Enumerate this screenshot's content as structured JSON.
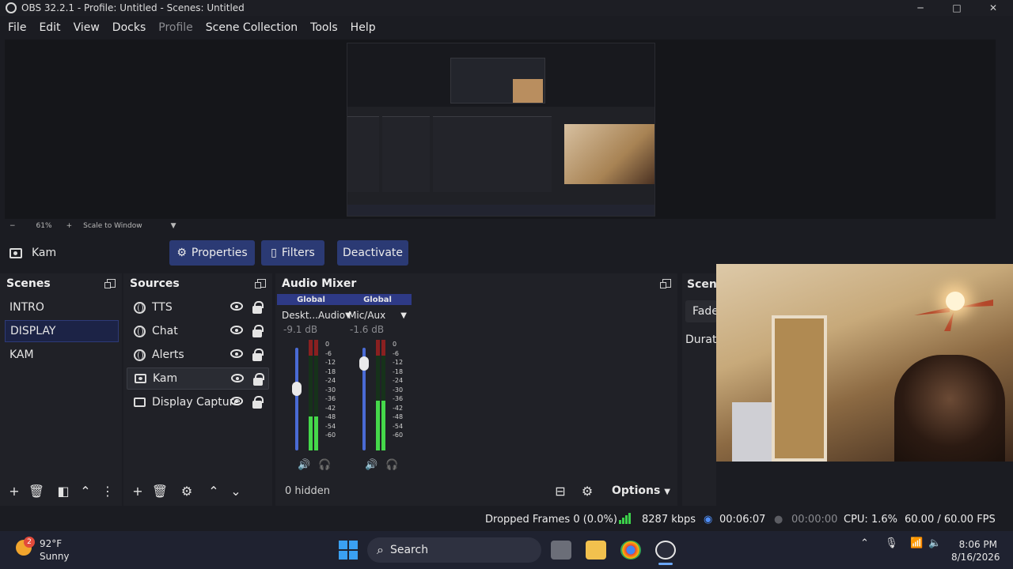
{
  "window": {
    "title": "OBS 32.2.1 - Profile: Untitled - Scenes: Untitled",
    "min": "─",
    "max": "□",
    "close": "✕"
  },
  "menu": [
    "File",
    "Edit",
    "View",
    "Docks",
    "Profile",
    "Scene Collection",
    "Tools",
    "Help"
  ],
  "zoom": {
    "minus": "−",
    "value": "61%",
    "plus": "+",
    "mode": "Scale to Window"
  },
  "current_source": {
    "name": "Kam",
    "properties": "Properties",
    "filters": "Filters",
    "deactivate": "Deactivate"
  },
  "scenes": {
    "title": "Scenes",
    "items": [
      "INTRO",
      "DISPLAY",
      "KAM"
    ],
    "selected": "DISPLAY"
  },
  "sources": {
    "title": "Sources",
    "items": [
      {
        "name": "TTS",
        "icon": "browser-icon",
        "visible": true
      },
      {
        "name": "Chat",
        "icon": "browser-icon",
        "visible": true
      },
      {
        "name": "Alerts",
        "icon": "browser-icon",
        "visible": true
      },
      {
        "name": "Kam",
        "icon": "camera-icon",
        "visible": true
      },
      {
        "name": "Display Capture",
        "icon": "monitor-icon",
        "visible": true
      }
    ],
    "selected": "Kam"
  },
  "mixer": {
    "title": "Audio Mixer",
    "channels": [
      {
        "tag": "Global",
        "name": "Deskt...Audio",
        "db": "-9.1 dB",
        "level": 0.62
      },
      {
        "tag": "Global",
        "name": "Mic/Aux",
        "db": "-1.6 dB",
        "level": 0.9
      }
    ],
    "ticks": [
      "0",
      "-6",
      "-12",
      "-18",
      "-24",
      "-30",
      "-36",
      "-42",
      "-48",
      "-54",
      "-60"
    ],
    "hidden": "0 hidden",
    "options": "Options"
  },
  "transitions": {
    "title": "Scene",
    "fade": "Fade",
    "duration": "Durati"
  },
  "status": {
    "dropped": "Dropped Frames 0 (0.0%)",
    "bitrate": "8287 kbps",
    "stream_time": "00:06:07",
    "rec_time": "00:00:00",
    "cpu": "CPU: 1.6%",
    "fps": "60.00 / 60.00 FPS"
  },
  "taskbar": {
    "temp": "92°F",
    "weather": "Sunny",
    "badge": "2",
    "search": "Search",
    "time": "8:06 PM",
    "date": "8/16/2026"
  },
  "colors": {
    "accent": "#2b3a74",
    "selected_scene": "#1c2346",
    "meter_green": "#45d84a",
    "fader_blue": "#4a6bd4"
  }
}
